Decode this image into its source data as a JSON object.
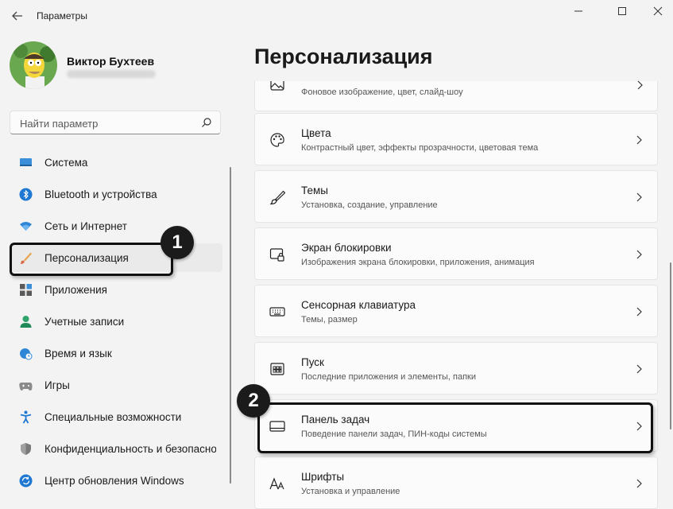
{
  "window": {
    "title": "Параметры"
  },
  "user": {
    "name": "Виктор Бухтеев"
  },
  "search": {
    "placeholder": "Найти параметр"
  },
  "nav": {
    "items": [
      {
        "label": "Система",
        "icon": "monitor-icon"
      },
      {
        "label": "Bluetooth и устройства",
        "icon": "bluetooth-icon"
      },
      {
        "label": "Сеть и Интернет",
        "icon": "wifi-icon"
      },
      {
        "label": "Персонализация",
        "icon": "brush-icon",
        "selected": true
      },
      {
        "label": "Приложения",
        "icon": "apps-icon"
      },
      {
        "label": "Учетные записи",
        "icon": "person-icon"
      },
      {
        "label": "Время и язык",
        "icon": "globe-clock-icon"
      },
      {
        "label": "Игры",
        "icon": "gamepad-icon"
      },
      {
        "label": "Специальные возможности",
        "icon": "accessibility-icon"
      },
      {
        "label": "Конфиденциальность и безопасность",
        "icon": "shield-icon"
      },
      {
        "label": "Центр обновления Windows",
        "icon": "update-icon"
      }
    ]
  },
  "page": {
    "title": "Персонализация"
  },
  "settings": [
    {
      "title": "",
      "desc": "Фоновое изображение, цвет, слайд-шоу",
      "icon": "picture-icon"
    },
    {
      "title": "Цвета",
      "desc": "Контрастный цвет, эффекты прозрачности, цветовая тема",
      "icon": "palette-icon"
    },
    {
      "title": "Темы",
      "desc": "Установка, создание, управление",
      "icon": "brush-icon"
    },
    {
      "title": "Экран блокировки",
      "desc": "Изображения экрана блокировки, приложения, анимация",
      "icon": "lock-screen-icon"
    },
    {
      "title": "Сенсорная клавиатура",
      "desc": "Темы, размер",
      "icon": "keyboard-icon"
    },
    {
      "title": "Пуск",
      "desc": "Последние приложения и элементы, папки",
      "icon": "start-icon"
    },
    {
      "title": "Панель задач",
      "desc": "Поведение панели задач, ПИН-коды системы",
      "icon": "taskbar-icon"
    },
    {
      "title": "Шрифты",
      "desc": "Установка и управление",
      "icon": "fonts-icon"
    }
  ],
  "annotations": {
    "badge1": "1",
    "badge2": "2"
  },
  "colors": {
    "accent": "#005fb8",
    "background": "#f3f3f3",
    "card": "#fbfbfb"
  }
}
